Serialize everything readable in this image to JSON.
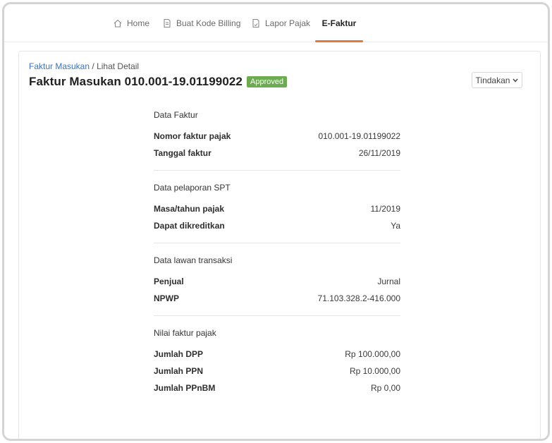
{
  "nav": {
    "items": [
      {
        "label": "Home",
        "icon": "home-icon"
      },
      {
        "label": "Buat Kode Billing",
        "icon": "document-icon"
      },
      {
        "label": "Lapor Pajak",
        "icon": "report-icon"
      },
      {
        "label": "E-Faktur",
        "icon": ""
      }
    ],
    "active_index": 3,
    "accent_color": "#e07b39"
  },
  "breadcrumb": {
    "parent": "Faktur Masukan",
    "separator": " / ",
    "current": "Lihat Detail"
  },
  "page": {
    "title": "Faktur Masukan 010.001-19.01199022",
    "status_badge": "Approved",
    "badge_color": "#6dab52",
    "action_label": "Tindakan"
  },
  "sections": [
    {
      "title": "Data Faktur",
      "rows": [
        {
          "label": "Nomor faktur pajak",
          "value": "010.001-19.01199022"
        },
        {
          "label": "Tanggal faktur",
          "value": "26/11/2019"
        }
      ]
    },
    {
      "title": "Data pelaporan SPT",
      "rows": [
        {
          "label": "Masa/tahun pajak",
          "value": "11/2019"
        },
        {
          "label": "Dapat dikreditkan",
          "value": "Ya"
        }
      ]
    },
    {
      "title": "Data lawan transaksi",
      "rows": [
        {
          "label": "Penjual",
          "value": "Jurnal"
        },
        {
          "label": "NPWP",
          "value": "71.103.328.2-416.000"
        }
      ]
    },
    {
      "title": "Nilai faktur pajak",
      "rows": [
        {
          "label": "Jumlah DPP",
          "value": "Rp 100.000,00"
        },
        {
          "label": "Jumlah PPN",
          "value": "Rp 10.000,00"
        },
        {
          "label": "Jumlah PPnBM",
          "value": "Rp 0,00"
        }
      ]
    }
  ]
}
